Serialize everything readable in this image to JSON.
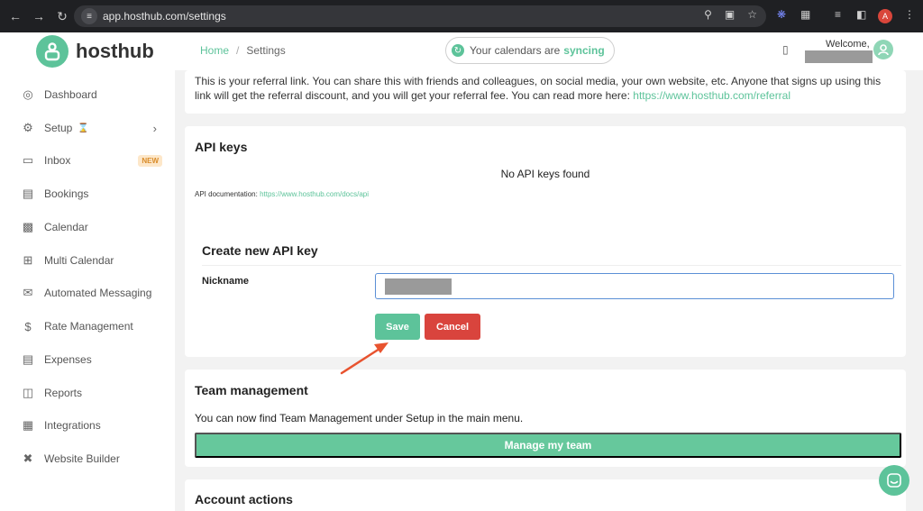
{
  "browser": {
    "url": "app.hosthub.com/settings",
    "profile_initial": "A"
  },
  "header": {
    "logo_text": "hosthub",
    "breadcrumb": {
      "home": "Home",
      "separator": "/",
      "current": "Settings"
    },
    "sync": {
      "text": "Your calendars are",
      "status": "syncing"
    },
    "welcome": "Welcome,"
  },
  "sidebar": {
    "items": [
      {
        "label": "Dashboard",
        "icon": "dashboard-icon"
      },
      {
        "label": "Setup",
        "icon": "gears-icon",
        "extra": "⌛"
      },
      {
        "label": "Inbox",
        "icon": "inbox-icon",
        "badge": "NEW"
      },
      {
        "label": "Bookings",
        "icon": "list-icon"
      },
      {
        "label": "Calendar",
        "icon": "calendar-icon"
      },
      {
        "label": "Multi Calendar",
        "icon": "calendar-plus-icon"
      },
      {
        "label": "Automated Messaging",
        "icon": "envelope-icon"
      },
      {
        "label": "Rate Management",
        "icon": "dollar-icon"
      },
      {
        "label": "Expenses",
        "icon": "receipt-icon"
      },
      {
        "label": "Reports",
        "icon": "chart-icon"
      },
      {
        "label": "Integrations",
        "icon": "store-icon"
      },
      {
        "label": "Website Builder",
        "icon": "tools-icon"
      }
    ]
  },
  "referral": {
    "text": "This is your referral link. You can share this with friends and colleagues, on social media, your own website, etc. Anyone that signs up using this link will get the referral discount, and you will get your referral fee. You can read more here:",
    "link": "https://www.hosthub.com/referral"
  },
  "api_keys": {
    "title": "API keys",
    "empty_message": "No API keys found",
    "doc_label": "API documentation:",
    "doc_link": "https://www.hosthub.com/docs/api",
    "create_title": "Create new API key",
    "nickname_label": "Nickname",
    "save_label": "Save",
    "cancel_label": "Cancel"
  },
  "team": {
    "title": "Team management",
    "text": "You can now find Team Management under Setup in the main menu.",
    "button_label": "Manage my team"
  },
  "account": {
    "title": "Account actions"
  },
  "colors": {
    "brand": "#5dc39a",
    "danger": "#d9443d",
    "annotation_arrow": "#e8532f"
  }
}
